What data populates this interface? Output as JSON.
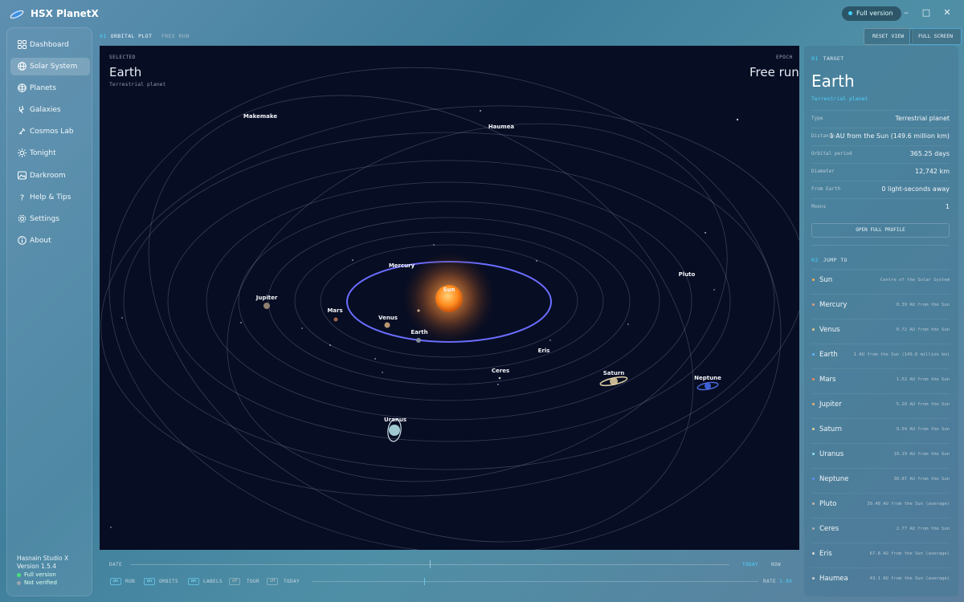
{
  "app": {
    "title": "HSX PlanetX",
    "version_pill": "Full version"
  },
  "sidebar": {
    "items": [
      {
        "label": "Dashboard",
        "icon": "grid-icon"
      },
      {
        "label": "Solar System",
        "icon": "globe-icon",
        "active": true
      },
      {
        "label": "Planets",
        "icon": "planet-icon"
      },
      {
        "label": "Galaxies",
        "icon": "galaxy-icon"
      },
      {
        "label": "Cosmos Lab",
        "icon": "flask-icon"
      },
      {
        "label": "Tonight",
        "icon": "sun-icon"
      },
      {
        "label": "Darkroom",
        "icon": "image-icon"
      },
      {
        "label": "Help & Tips",
        "icon": "question-icon"
      },
      {
        "label": "Settings",
        "icon": "gear-icon"
      },
      {
        "label": "About",
        "icon": "info-icon"
      }
    ],
    "brand": "Hasnain Studio X",
    "version": "Version 1.5.4",
    "status_full": "Full version",
    "status_verified": "Not verified"
  },
  "tabs": [
    {
      "num": "01",
      "label": "ORBITAL PLOT"
    },
    {
      "label": "FREE RUN"
    }
  ],
  "top_buttons": {
    "reset": "RESET VIEW",
    "fullscreen": "FULL SCREEN"
  },
  "canvas": {
    "selected_label": "SELECTED",
    "selected_name": "Earth",
    "selected_type": "Terrestrial planet",
    "epoch_label": "EPOCH",
    "epoch_value": "Free run",
    "bodies": [
      {
        "name": "Sun"
      },
      {
        "name": "Mercury"
      },
      {
        "name": "Venus"
      },
      {
        "name": "Earth"
      },
      {
        "name": "Mars"
      },
      {
        "name": "Jupiter"
      },
      {
        "name": "Saturn"
      },
      {
        "name": "Uranus"
      },
      {
        "name": "Neptune"
      },
      {
        "name": "Pluto"
      },
      {
        "name": "Ceres"
      },
      {
        "name": "Eris"
      },
      {
        "name": "Haumea"
      },
      {
        "name": "Makemake"
      }
    ]
  },
  "bottom": {
    "date_label": "DATE",
    "today": "TODAY",
    "now": "NOW",
    "toggles": [
      "RUN",
      "ORBITS",
      "LABELS",
      "TOUR",
      "TODAY"
    ],
    "rate_label": "RATE",
    "rate_value": "1.0X"
  },
  "target": {
    "section_num": "01",
    "section_label": "TARGET",
    "name": "Earth",
    "type": "Terrestrial planet",
    "rows": [
      {
        "key": "Type",
        "value": "Terrestrial planet"
      },
      {
        "key": "Distance",
        "value": "1 AU from the Sun (149.6 million km)"
      },
      {
        "key": "Orbital period",
        "value": "365.25 days"
      },
      {
        "key": "Diameter",
        "value": "12,742 km"
      },
      {
        "key": "From Earth",
        "value": "0 light-seconds away"
      },
      {
        "key": "Moons",
        "value": "1"
      }
    ],
    "profile_button": "OPEN FULL PROFILE"
  },
  "jump": {
    "section_num": "02",
    "section_label": "JUMP TO",
    "items": [
      {
        "name": "Sun",
        "desc": "Centre of the Solar System",
        "color": "#ffb04a"
      },
      {
        "name": "Mercury",
        "desc": "0.39 AU from the Sun",
        "color": "#d9a07a"
      },
      {
        "name": "Venus",
        "desc": "0.72 AU from the Sun",
        "color": "#e4c88a"
      },
      {
        "name": "Earth",
        "desc": "1 AU from the Sun (149.6 million km)",
        "color": "#5fb8ff"
      },
      {
        "name": "Mars",
        "desc": "1.52 AU from the Sun",
        "color": "#ff8a5a"
      },
      {
        "name": "Jupiter",
        "desc": "5.20 AU from the Sun",
        "color": "#e8b27a"
      },
      {
        "name": "Saturn",
        "desc": "9.54 AU from the Sun",
        "color": "#e7d39a"
      },
      {
        "name": "Uranus",
        "desc": "19.19 AU from the Sun",
        "color": "#8fe0ee"
      },
      {
        "name": "Neptune",
        "desc": "30.07 AU from the Sun",
        "color": "#5f8fff"
      },
      {
        "name": "Pluto",
        "desc": "39.48 AU from the Sun (average)",
        "color": "#c9b8a8"
      },
      {
        "name": "Ceres",
        "desc": "2.77 AU from the Sun",
        "color": "#b0b0b0"
      },
      {
        "name": "Eris",
        "desc": "67.8 AU from the Sun (average)",
        "color": "#dcdcdc"
      },
      {
        "name": "Haumea",
        "desc": "43.1 AU from the Sun (average)",
        "color": "#d0d0d0"
      }
    ]
  }
}
